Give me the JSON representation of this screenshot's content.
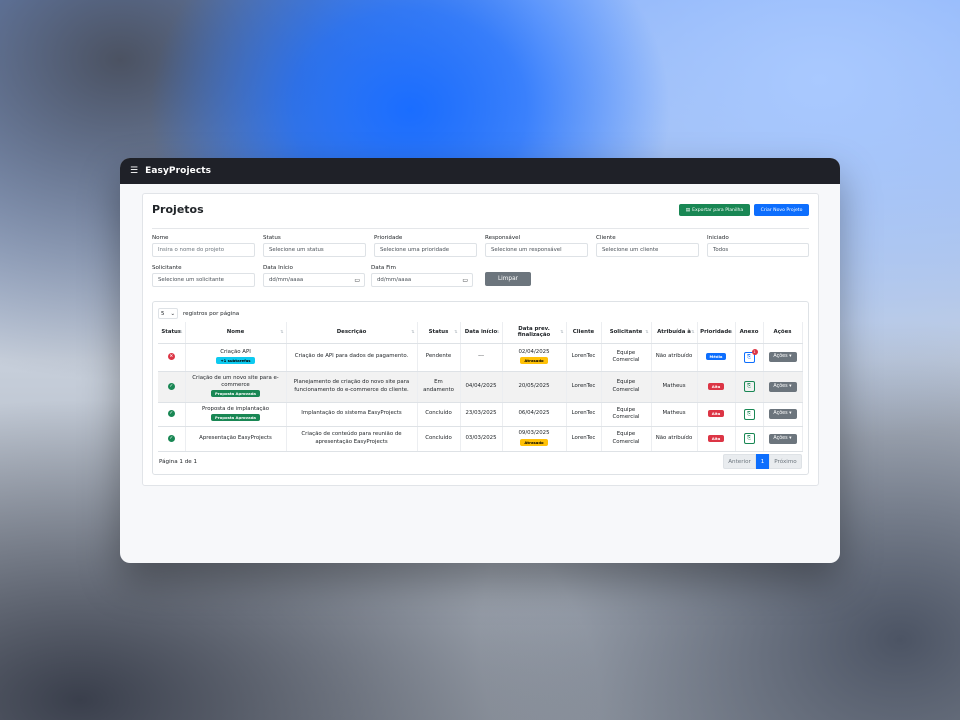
{
  "app": {
    "brand": "EasyProjects"
  },
  "page": {
    "title": "Projetos",
    "export_label": "Exportar para Planilha",
    "new_label": "Criar Novo Projeto"
  },
  "filters": {
    "nome": {
      "label": "Nome",
      "placeholder": "Insira o nome do projeto"
    },
    "status": {
      "label": "Status",
      "value": "Selecione um status"
    },
    "prioridade": {
      "label": "Prioridade",
      "value": "Selecione uma prioridade"
    },
    "responsavel": {
      "label": "Responsável",
      "value": "Selecione um responsável"
    },
    "cliente": {
      "label": "Cliente",
      "value": "Selecione um cliente"
    },
    "iniciado": {
      "label": "Iniciado",
      "value": "Todos"
    },
    "solicitante": {
      "label": "Solicitante",
      "value": "Selecione um solicitante"
    },
    "data_inicio": {
      "label": "Data Início",
      "value": "dd/mm/aaaa"
    },
    "data_fim": {
      "label": "Data Fim",
      "value": "dd/mm/aaaa"
    },
    "clear_label": "Limpar"
  },
  "table": {
    "per_page_value": "5",
    "per_page_label": "registros por página",
    "headers": [
      "Status",
      "Nome",
      "Descrição",
      "Status",
      "Data início",
      "Data prev. finalização",
      "Cliente",
      "Solicitante",
      "Atribuída à",
      "Prioridade",
      "Anexo",
      "Ações"
    ],
    "rows": [
      {
        "status_color": "#dc3545",
        "name": "Criação API",
        "name_badge": "+1 subtarefas",
        "desc": "Criação de API para dados de pagamento.",
        "status": "Pendente",
        "start": "---",
        "end": "02/04/2025",
        "end_badge": "Atrasado",
        "client": "LorenTec",
        "requester": "Equipe Comercial",
        "assigned": "Não atribuído",
        "priority": "Média",
        "priority_color": "#0d6efd",
        "attach_count": "1",
        "actions": "Ações"
      },
      {
        "status_color": "#198754",
        "name": "Criação de um novo site para e-commerce",
        "name_badge": "Proposta Aprovada",
        "desc": "Planejamento de criação do novo site para funcionamento do e-commerce do cliente.",
        "status": "Em andamento",
        "start": "04/04/2025",
        "end": "20/05/2025",
        "end_badge": "",
        "client": "LorenTec",
        "requester": "Equipe Comercial",
        "assigned": "Matheus",
        "priority": "Alta",
        "priority_color": "#dc3545",
        "attach_count": "",
        "actions": "Ações"
      },
      {
        "status_color": "#198754",
        "name": "Proposta de implantação",
        "name_badge": "Proposta Aprovada",
        "desc": "Implantação do sistema EasyProjects",
        "status": "Concluído",
        "start": "23/03/2025",
        "end": "06/04/2025",
        "end_badge": "",
        "client": "LorenTec",
        "requester": "Equipe Comercial",
        "assigned": "Matheus",
        "priority": "Alta",
        "priority_color": "#dc3545",
        "attach_count": "",
        "actions": "Ações"
      },
      {
        "status_color": "#198754",
        "name": "Apresentação EasyProjects",
        "name_badge": "",
        "desc": "Criação de conteúdo para reunião de apresentação EasyProjects",
        "status": "Concluído",
        "start": "03/03/2025",
        "end": "09/03/2025",
        "end_badge": "Atrasado",
        "client": "LorenTec",
        "requester": "Equipe Comercial",
        "assigned": "Não atribuído",
        "priority": "Alta",
        "priority_color": "#dc3545",
        "attach_count": "",
        "actions": "Ações"
      }
    ]
  },
  "pagination": {
    "info": "Página 1 de 1",
    "prev": "Anterior",
    "current": "1",
    "next": "Próximo"
  }
}
